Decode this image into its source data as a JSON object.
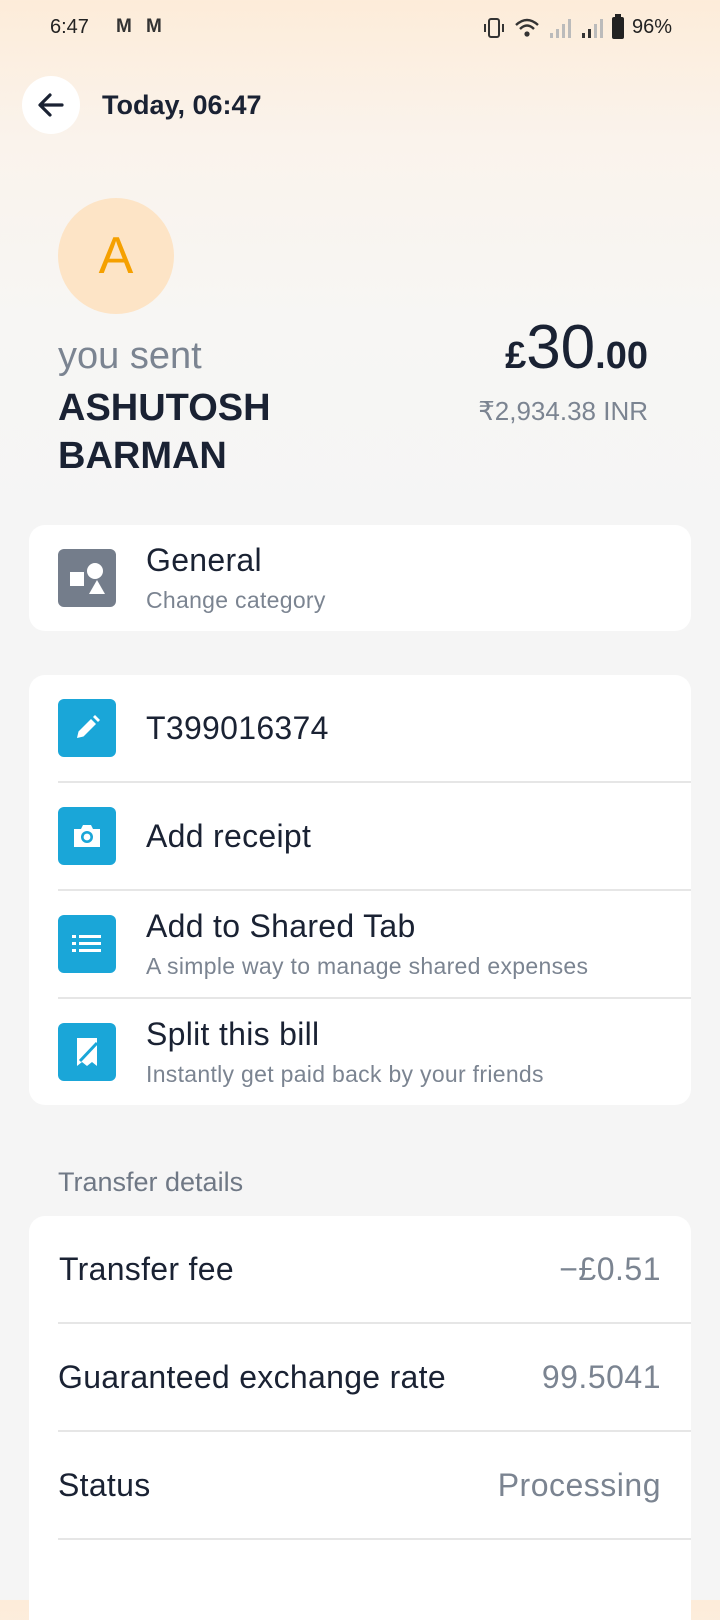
{
  "status_bar": {
    "time": "6:47",
    "gmail1": "M",
    "gmail2": "M",
    "battery": "96%"
  },
  "header": {
    "title": "Today, 06:47"
  },
  "recipient": {
    "initial": "A",
    "sent_label": "you sent",
    "name": "ASHUTOSH BARMAN"
  },
  "amount": {
    "currency": "£",
    "main": "30",
    "decimals": ".00",
    "converted": "₹2,934.38 INR"
  },
  "category": {
    "title": "General",
    "subtitle": "Change category"
  },
  "actions": [
    {
      "title": "T399016374",
      "subtitle": ""
    },
    {
      "title": "Add receipt",
      "subtitle": ""
    },
    {
      "title": "Add to Shared Tab",
      "subtitle": "A simple way to manage shared expenses"
    },
    {
      "title": "Split this bill",
      "subtitle": "Instantly get paid back by your friends"
    }
  ],
  "transfer": {
    "section_title": "Transfer details",
    "rows": [
      {
        "label": "Transfer fee",
        "value": "−£0.51"
      },
      {
        "label": "Guaranteed exchange rate",
        "value": "99.5041"
      },
      {
        "label": "Status",
        "value": "Processing"
      }
    ]
  },
  "colors": {
    "accent": "#1aa6d8",
    "avatar_bg": "#fde4c6",
    "avatar_text": "#f5a000",
    "category_icon": "#747d8b"
  }
}
